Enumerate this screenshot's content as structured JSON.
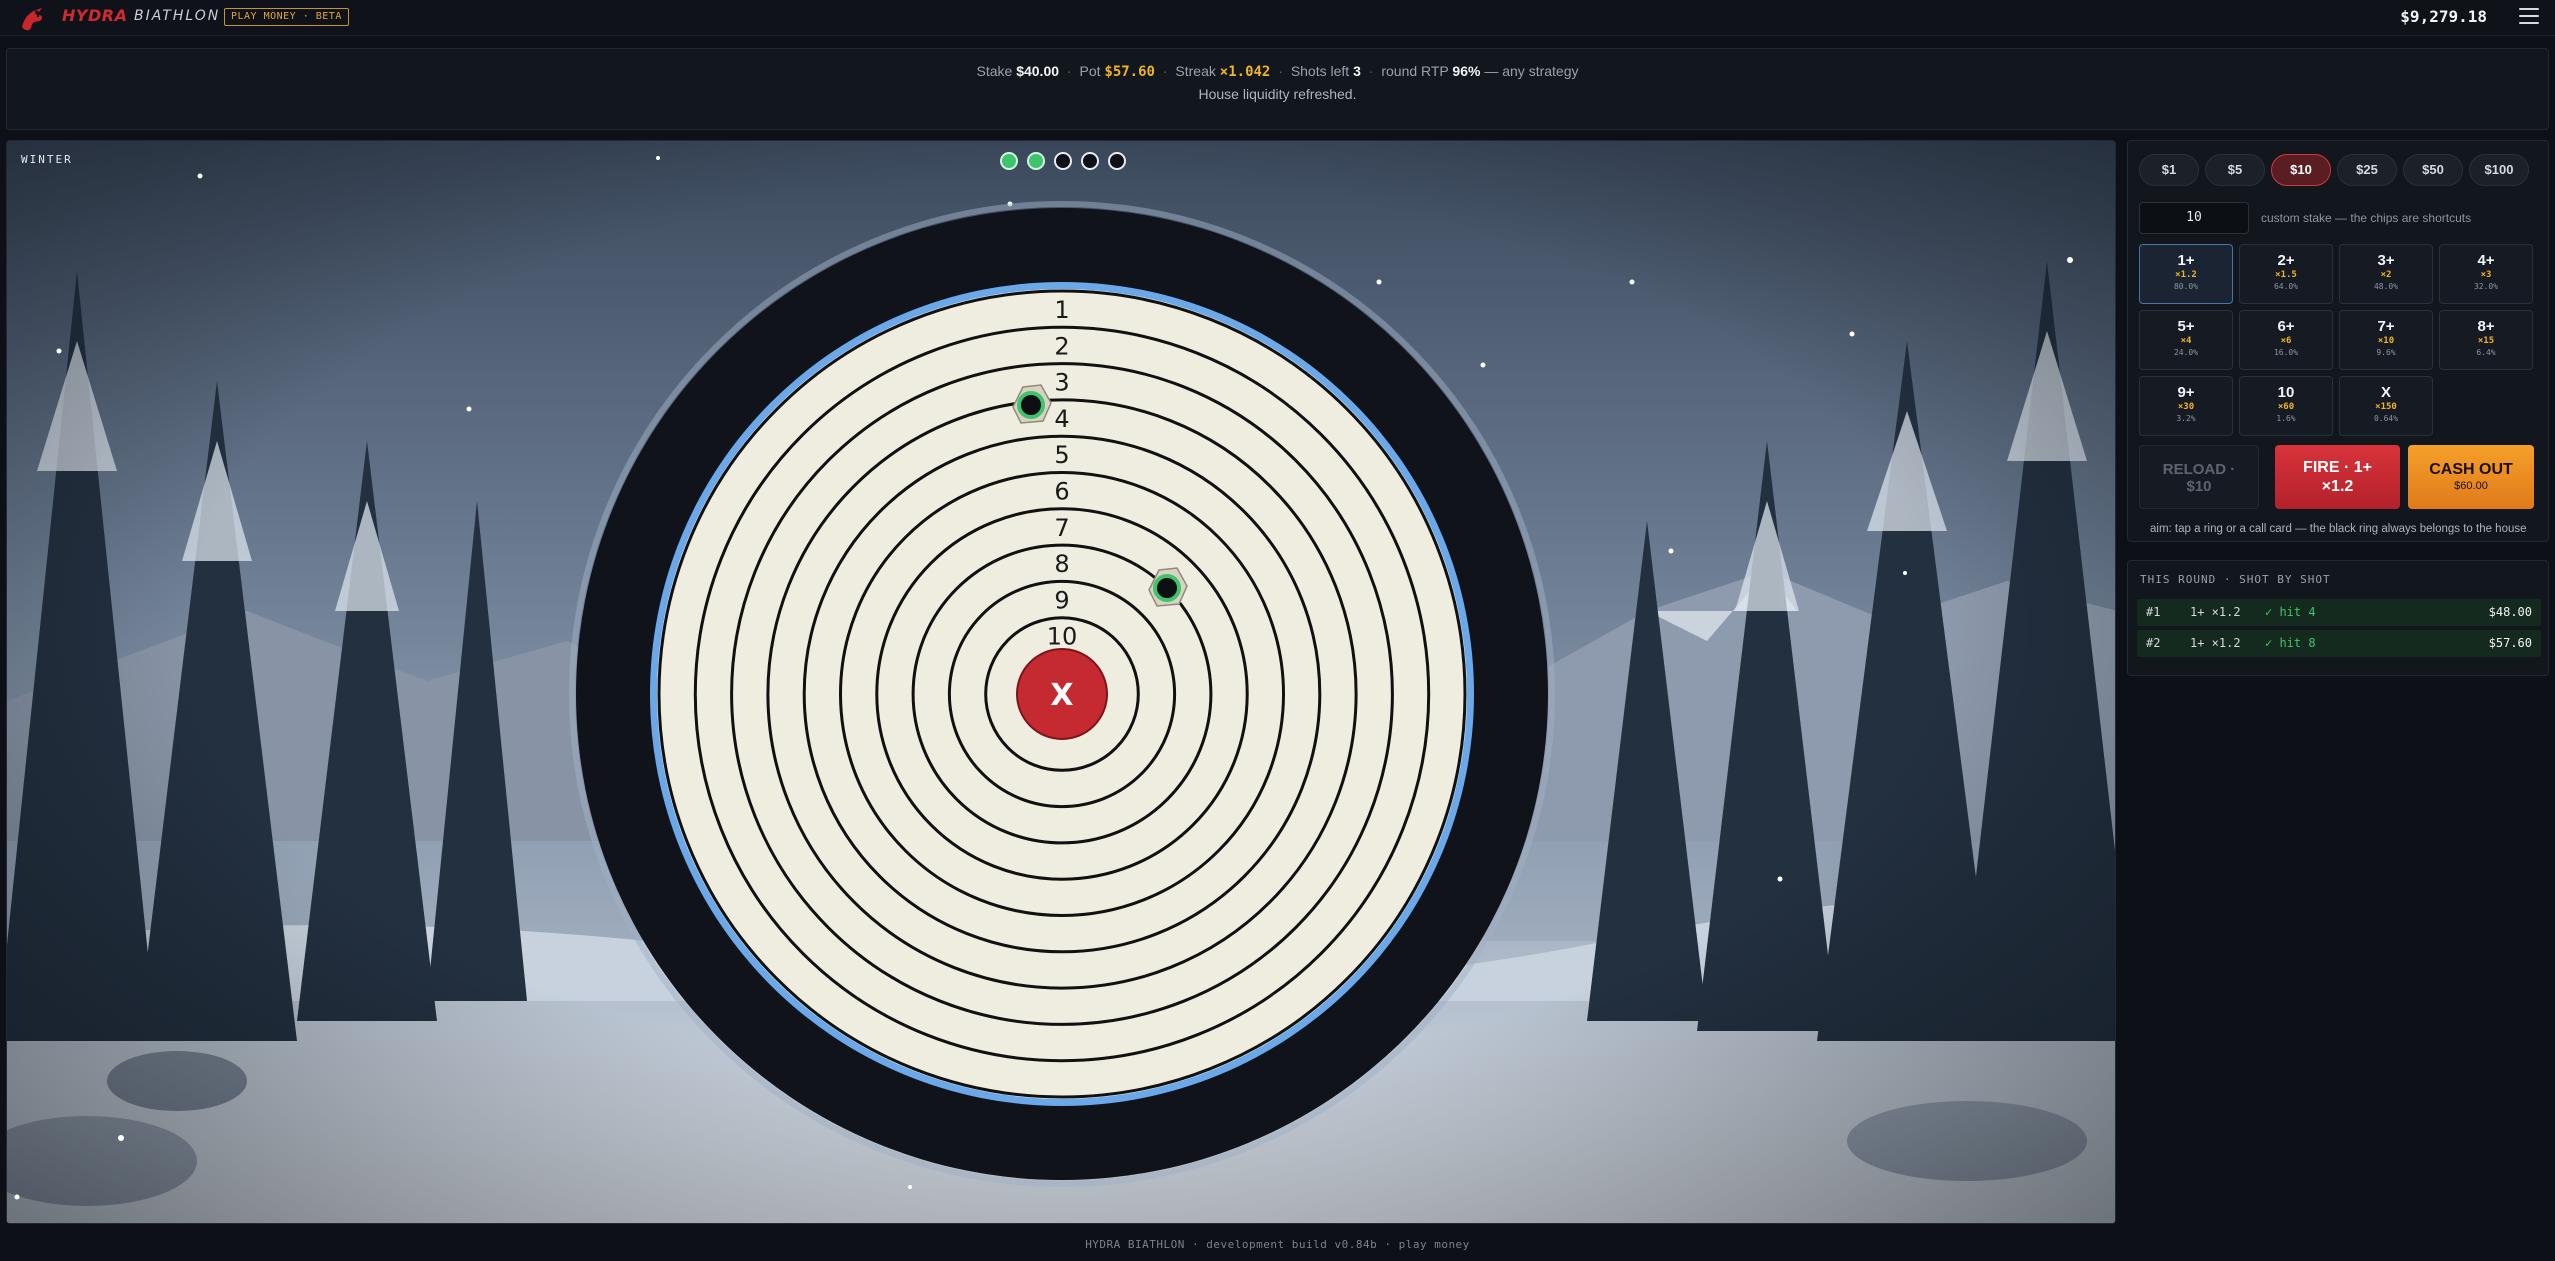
{
  "header": {
    "brand": "HYDRA",
    "product": "BIATHLON",
    "badge": "PLAY MONEY · BETA",
    "balance": "$9,279.18"
  },
  "status": {
    "stake_label": "Stake",
    "stake_value": "$40.00",
    "pot_label": "Pot",
    "pot_value": "$57.60",
    "streak_label": "Streak",
    "streak_value": "×1.042",
    "shots_label": "Shots left",
    "shots_value": "3",
    "rtp_label": "round RTP",
    "rtp_value": "96%",
    "rtp_suffix": "— any strategy",
    "message": "House liquidity refreshed."
  },
  "scene": {
    "season": "WINTER",
    "shots": [
      "hit",
      "hit",
      "empty",
      "empty",
      "empty"
    ],
    "ring_numbers": [
      "1",
      "2",
      "3",
      "4",
      "5",
      "6",
      "7",
      "8",
      "9",
      "10"
    ],
    "bullseye": "X"
  },
  "chips": [
    {
      "label": "$1",
      "selected": false
    },
    {
      "label": "$5",
      "selected": false
    },
    {
      "label": "$10",
      "selected": true
    },
    {
      "label": "$25",
      "selected": false
    },
    {
      "label": "$50",
      "selected": false
    },
    {
      "label": "$100",
      "selected": false
    }
  ],
  "custom_stake": {
    "value": "10",
    "hint": "custom stake — the chips are shortcuts"
  },
  "call_cards": [
    {
      "label": "1+",
      "mult": "×1.2",
      "prob": "80.0%",
      "selected": true
    },
    {
      "label": "2+",
      "mult": "×1.5",
      "prob": "64.0%",
      "selected": false
    },
    {
      "label": "3+",
      "mult": "×2",
      "prob": "48.0%",
      "selected": false
    },
    {
      "label": "4+",
      "mult": "×3",
      "prob": "32.0%",
      "selected": false
    },
    {
      "label": "5+",
      "mult": "×4",
      "prob": "24.0%",
      "selected": false
    },
    {
      "label": "6+",
      "mult": "×6",
      "prob": "16.0%",
      "selected": false
    },
    {
      "label": "7+",
      "mult": "×10",
      "prob": "9.6%",
      "selected": false
    },
    {
      "label": "8+",
      "mult": "×15",
      "prob": "6.4%",
      "selected": false
    },
    {
      "label": "9+",
      "mult": "×30",
      "prob": "3.2%",
      "selected": false
    },
    {
      "label": "10",
      "mult": "×60",
      "prob": "1.6%",
      "selected": false
    },
    {
      "label": "X",
      "mult": "×150",
      "prob": "0.64%",
      "selected": false
    }
  ],
  "actions": {
    "reload_line1": "RELOAD ·",
    "reload_line2": "$10",
    "fire_line1": "FIRE · 1+",
    "fire_line2": "×1.2",
    "cashout_line1": "CASH OUT",
    "cashout_line2": "$60.00"
  },
  "aim_hint": "aim: tap a ring or a call card — the black ring always belongs to the house",
  "history": {
    "title": "THIS ROUND · SHOT BY SHOT",
    "rows": [
      {
        "num": "#1",
        "call": "1+ ×1.2",
        "result": "✓ hit 4",
        "amount": "$48.00"
      },
      {
        "num": "#2",
        "call": "1+ ×1.2",
        "result": "✓ hit 8",
        "amount": "$57.60"
      }
    ]
  },
  "footer": "HYDRA BIATHLON · development build v0.84b · play money",
  "colors": {
    "accent_red": "#d6353c",
    "gold": "#f0b429",
    "hit_green": "#3ec46d",
    "target_outer_ring": "#6aa8ea",
    "target_paper": "#efece0"
  }
}
